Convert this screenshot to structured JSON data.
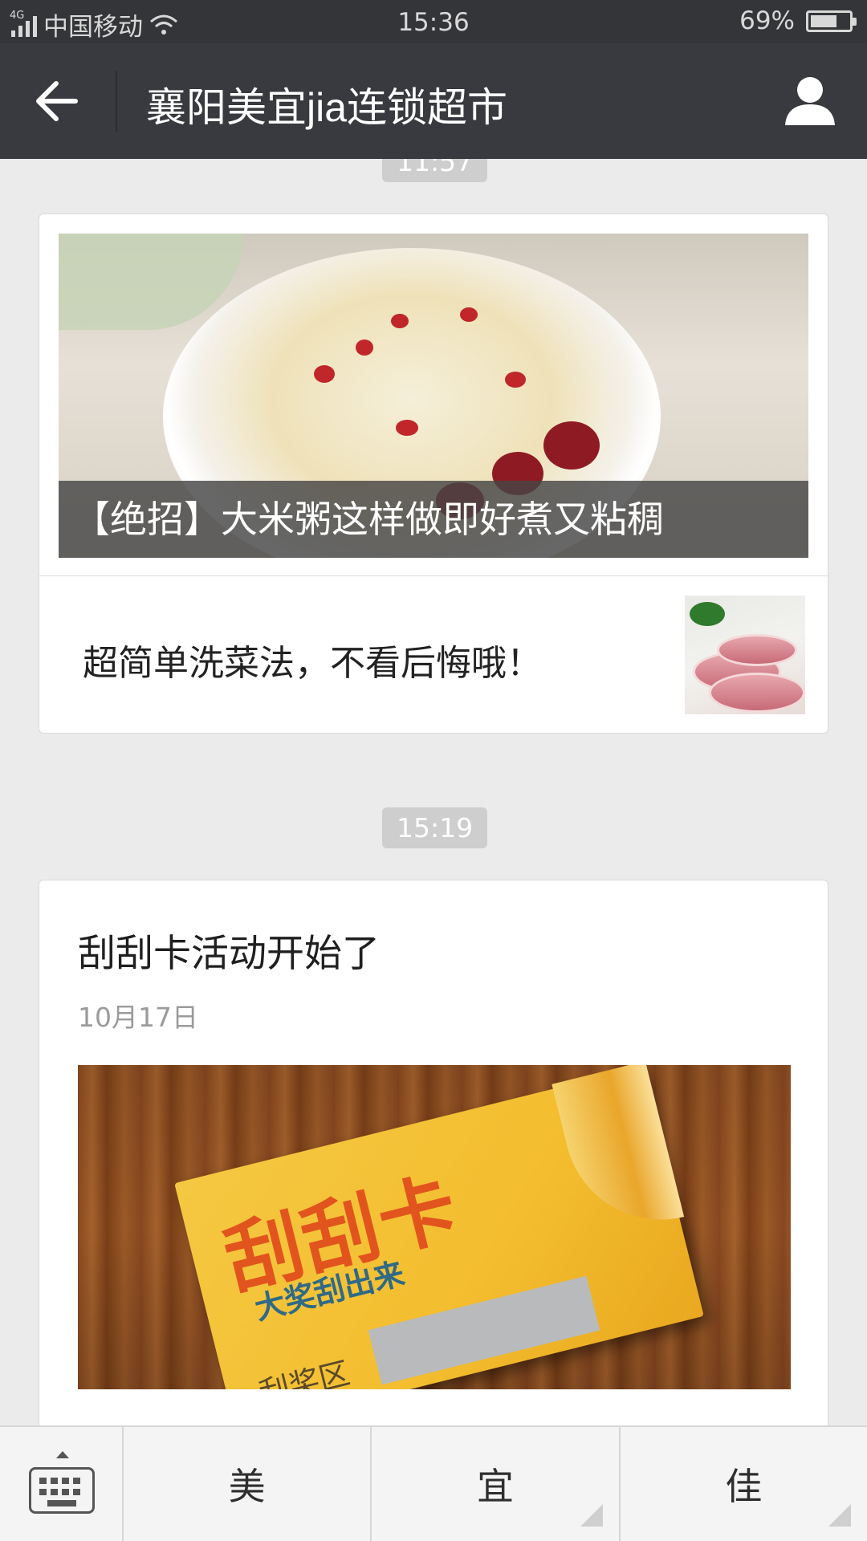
{
  "status_bar": {
    "network": "4G",
    "carrier": "中国移动",
    "time": "15:36",
    "battery_percent": "69%",
    "battery_level": 0.69
  },
  "nav": {
    "title": "襄阳美宜jia连锁超市",
    "back_icon": "arrow-left-icon",
    "profile_icon": "person-icon"
  },
  "messages": [
    {
      "time": "11:57",
      "cover_title": "【绝招】大米粥这样做即好煮又粘稠",
      "sub_items": [
        {
          "title": "超简单洗菜法，不看后悔哦！"
        }
      ]
    },
    {
      "time": "15:19",
      "article_title": "刮刮卡活动开始了",
      "article_date": "10月17日",
      "cover_text": {
        "main": "刮刮卡",
        "sub": "大奖刮出来",
        "area_label": "刮奖区"
      }
    }
  ],
  "bottom_menu": {
    "keyboard_icon": "keyboard-icon",
    "items": [
      "美",
      "宜",
      "佳"
    ]
  },
  "colors": {
    "status_bar_bg": "#343538",
    "nav_bg": "#393a3f",
    "chat_bg": "#ebebeb",
    "time_pill_bg": "#cecece"
  }
}
